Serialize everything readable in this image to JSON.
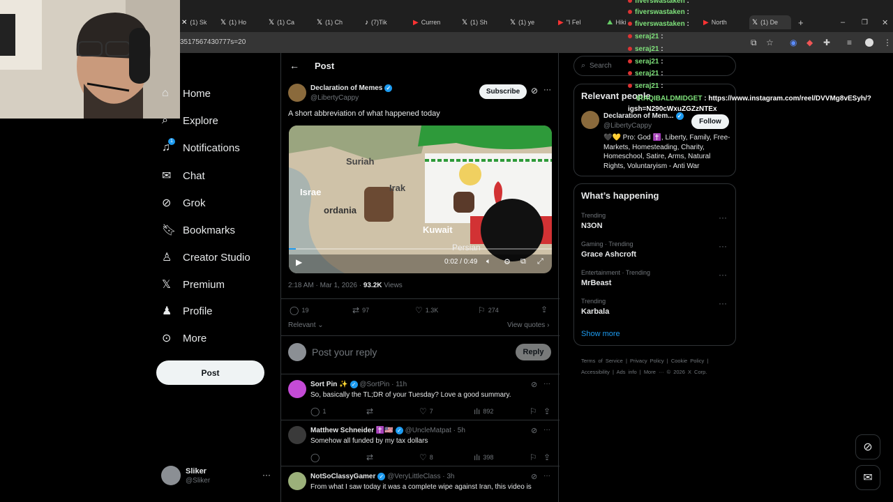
{
  "browser": {
    "tabs": [
      "(1) Sk",
      "(1) Ho",
      "(1) Ca",
      "(1) Ch",
      "(7)Tik",
      "Curren",
      "(1) Sh",
      "(1) ye",
      "\"I Fel",
      "Hiki",
      "North",
      "(1) De"
    ],
    "url": "3517567430777s=20"
  },
  "nav": {
    "items": [
      {
        "label": "Home",
        "icon": "home-icon"
      },
      {
        "label": "Explore",
        "icon": "search-icon"
      },
      {
        "label": "Notifications",
        "icon": "bell-icon",
        "badge": "1"
      },
      {
        "label": "Chat",
        "icon": "mail-icon"
      },
      {
        "label": "Grok",
        "icon": "grok-icon"
      },
      {
        "label": "Bookmarks",
        "icon": "bookmark-icon"
      },
      {
        "label": "Creator Studio",
        "icon": "creator-icon"
      },
      {
        "label": "Premium",
        "icon": "x-icon"
      },
      {
        "label": "Profile",
        "icon": "person-icon"
      },
      {
        "label": "More",
        "icon": "more-circle-icon"
      }
    ],
    "post_label": "Post",
    "account": {
      "name": "Sliker",
      "handle": "@Sliker"
    }
  },
  "post": {
    "header_title": "Post",
    "author_name": "Declaration of Memes",
    "author_handle": "@LibertyCappy",
    "subscribe_label": "Subscribe",
    "text": "A short abbreviation of what happened today",
    "video": {
      "labels": {
        "suriah": "Suriah",
        "israel": "Israe",
        "irak": "Irak",
        "jordania": "ordania",
        "kuwait": "Kuwait",
        "persian": "Persian"
      },
      "time": "0:02 / 0:49"
    },
    "timestamp": "2:18 AM · Mar 1, 2026 · ",
    "views_count": "93.2K",
    "views_label": " Views",
    "replies": "19",
    "reposts": "97",
    "likes": "1.3K",
    "bookmarks": "274",
    "relevant_label": "Relevant",
    "view_quotes_label": "View quotes",
    "reply_placeholder": "Post your reply",
    "reply_button": "Reply"
  },
  "replies": [
    {
      "name": "Sort Pin ✨",
      "handle": "@SortPin · 11h",
      "text": "So, basically the TL;DR of your Tuesday? Love a good summary.",
      "replies": "1",
      "reposts": "",
      "likes": "7",
      "views": "892",
      "avatar_color": "#c44bd6"
    },
    {
      "name": "Matthew Schneider ✝️🇺🇸",
      "handle": "@UncleMatpat · 5h",
      "text": "Somehow all funded by my tax dollars",
      "replies": "",
      "reposts": "",
      "likes": "8",
      "views": "398",
      "avatar_color": "#3a3a3a"
    },
    {
      "name": "NotSoClassyGamer",
      "handle": "@VeryLittleClass · 3h",
      "text": "From what I saw today it was a complete wipe against Iran, this video is",
      "replies": "",
      "reposts": "",
      "likes": "",
      "views": "",
      "avatar_color": "#9bb07a"
    }
  ],
  "search": {
    "placeholder": "Search"
  },
  "relevant": {
    "title": "Relevant people",
    "name": "Declaration of Mem...",
    "handle": "@LibertyCappy",
    "follow_label": "Follow",
    "bio": "🖤💛 Pro: God ✝️, Liberty, Family, Free-Markets, Homesteading, Charity, Homeschool, Satire, Arms, Natural Rights, Voluntaryism - Anti War"
  },
  "happening": {
    "title": "What’s happening",
    "trends": [
      {
        "meta": "Trending",
        "name": "N3ON"
      },
      {
        "meta": "Gaming · Trending",
        "name": "Grace Ashcroft"
      },
      {
        "meta": "Entertainment · Trending",
        "name": "MrBeast"
      },
      {
        "meta": "Trending",
        "name": "Karbala"
      }
    ],
    "show_more": "Show more"
  },
  "footer": {
    "links": [
      "Terms of Service",
      "|",
      "Privacy Policy",
      "|",
      "Cookie Policy",
      "|",
      "Accessibility",
      "|",
      "Ads info",
      "|",
      "More ···",
      "© 2026 X Corp."
    ]
  },
  "chat_overlay": [
    {
      "user": "fiverswastaken",
      "text": ":"
    },
    {
      "user": "fiverswastaken",
      "text": ":"
    },
    {
      "user": "seraj21",
      "text": ":"
    },
    {
      "user": "seraj21",
      "text": ":"
    },
    {
      "user": "seraj21",
      "text": ":"
    },
    {
      "user": "seraj21",
      "text": ":"
    },
    {
      "user": "seraj21",
      "text": ":"
    }
  ],
  "chat_link": {
    "user": "IRAQIBALDMIDGET",
    "text": ": https://www.instagram.com/reel/DVVMg8vESyh/?",
    "text2": "igsh=N290cWxuZGZzNTEx"
  },
  "colors": {
    "accent": "#1d9bf0",
    "background": "#000000",
    "border": "#2f3336",
    "chat_user": "#7ee07a"
  }
}
